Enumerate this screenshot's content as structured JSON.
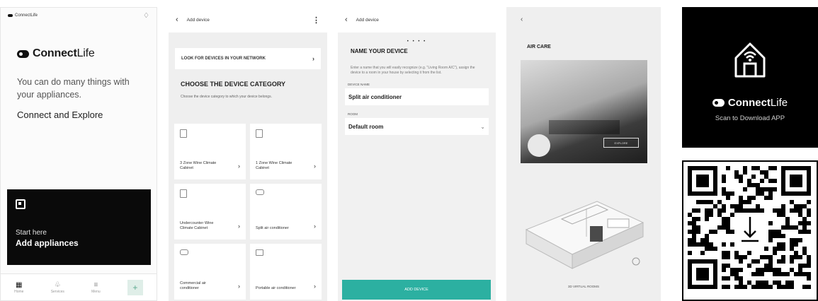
{
  "screen1": {
    "status": "ConnectLife",
    "brand_bold": "Connect",
    "brand_light": "Life",
    "intro": "You can do many things with your appliances.",
    "cta": "Connect and Explore",
    "start_small": "Start here",
    "start_big": "Add appliances",
    "nav": [
      {
        "label": "Home",
        "icon": "grid-icon"
      },
      {
        "label": "Services",
        "icon": "leaf-icon"
      },
      {
        "label": "Menu",
        "icon": "menu-icon"
      }
    ],
    "plus": "+"
  },
  "screen2": {
    "header_title": "Add device",
    "look_label": "LOOK FOR DEVICES IN YOUR NETWORK",
    "category_title": "CHOOSE THE DEVICE CATEGORY",
    "category_desc": "Choose the device category to which your device belongs.",
    "tiles": [
      {
        "label": "3 Zone Wine Climate Cabinet"
      },
      {
        "label": "1 Zone Wine Climate Cabinet"
      },
      {
        "label": "Undercounter Wine Climate Cabinet"
      },
      {
        "label": "Split air conditioner"
      },
      {
        "label": "Commercial air conditioner"
      },
      {
        "label": "Portable air conditioner"
      }
    ]
  },
  "screen3": {
    "header_title": "Add device",
    "dots": "• • • •",
    "title": "NAME YOUR DEVICE",
    "desc": "Enter a name that you will easily recognize (e.g. \"Living Room A/C\"), assign the device to a room in your house by selecting it from the list.",
    "name_label": "DEVICE NAME",
    "name_value": "Split air conditioner",
    "room_label": "ROOM",
    "room_value": "Default room",
    "button": "ADD DEVICE"
  },
  "screen4": {
    "title": "AIR CARE",
    "photo_button": "EXPLORE",
    "virtual": "3D VIRTUAL ROOMS"
  },
  "promo": {
    "brand_bold": "Connect",
    "brand_light": "Life",
    "scan": "Scan to Download APP"
  },
  "colors": {
    "accent": "#2cb0a1",
    "dark": "#0a0a0a"
  }
}
